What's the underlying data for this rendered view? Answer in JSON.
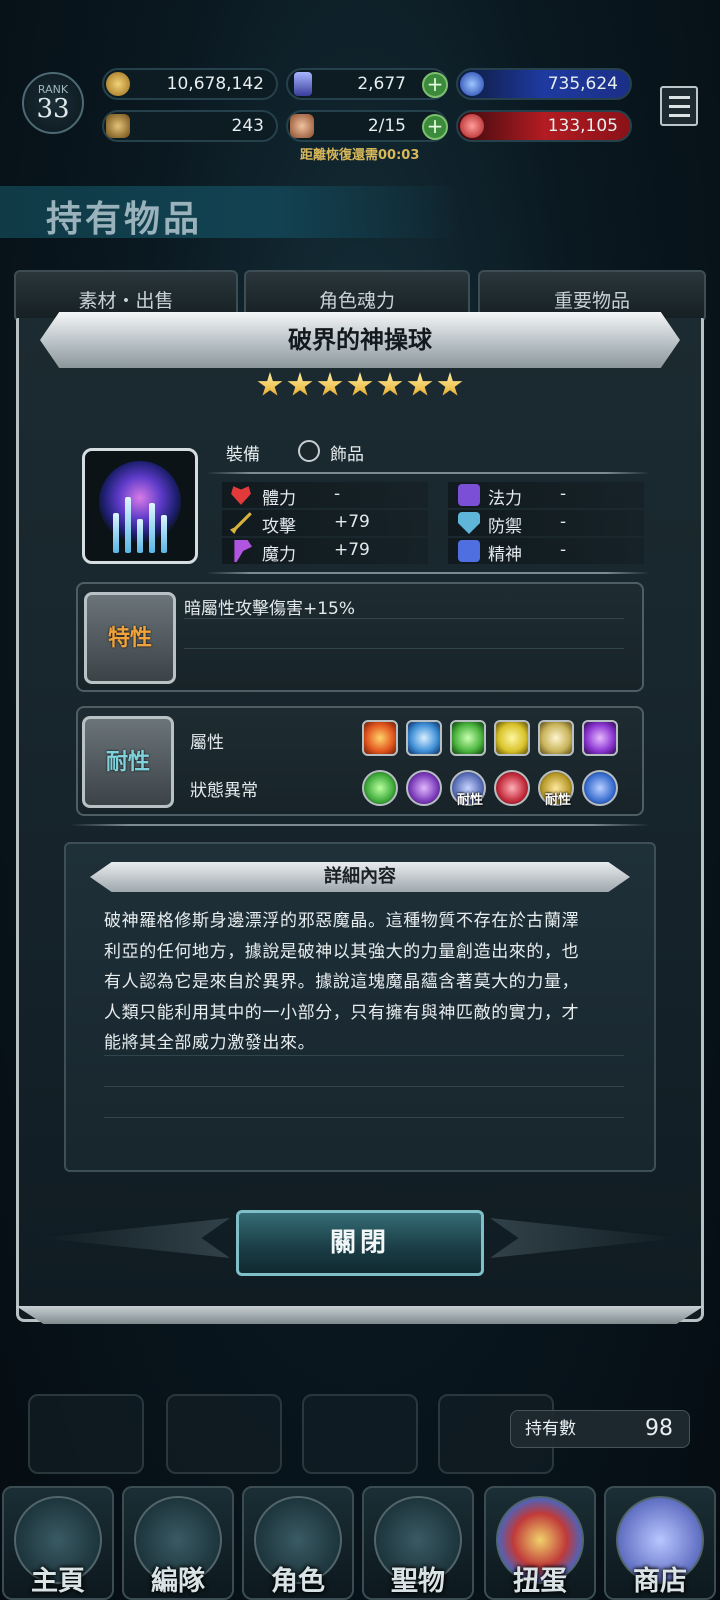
{
  "top": {
    "rank_label": "RANK",
    "rank_value": "33",
    "gold": "10,678,142",
    "crystal": "2,677",
    "blue_res": "735,624",
    "trophy": "243",
    "stamina": "2/15",
    "red_res": "133,105",
    "recover_text": "距離恢復還需00:03"
  },
  "page": {
    "title": "持有物品",
    "tabs": [
      "素材・出售",
      "角色魂力",
      "重要物品"
    ]
  },
  "item": {
    "name": "破界的神操球",
    "stars": 7,
    "equip_label": "裝備",
    "equip_type": "飾品",
    "stats": [
      {
        "label": "體力",
        "value": "-",
        "icon": "heart-icon",
        "color": "#e23a3a"
      },
      {
        "label": "法力",
        "value": "-",
        "icon": "mana-icon",
        "color": "#7b4fd6"
      },
      {
        "label": "攻擊",
        "value": "+79",
        "icon": "sword-icon",
        "color": "#d8b23a"
      },
      {
        "label": "防禦",
        "value": "-",
        "icon": "shield-icon",
        "color": "#5fb6d8"
      },
      {
        "label": "魔力",
        "value": "+79",
        "icon": "magic-icon",
        "color": "#b055e0"
      },
      {
        "label": "精神",
        "value": "-",
        "icon": "spirit-icon",
        "color": "#4f6ee0"
      }
    ],
    "trait_badge": "特性",
    "trait_text": "暗屬性攻擊傷害+15%",
    "resist_badge": "耐性",
    "attr_label": "屬性",
    "status_label": "狀態異常",
    "attr_icons": [
      {
        "name": "fire-element-icon",
        "color": "#e2561e"
      },
      {
        "name": "ice-element-icon",
        "color": "#3d8ed6"
      },
      {
        "name": "wind-element-icon",
        "color": "#49b33c"
      },
      {
        "name": "lightning-element-icon",
        "color": "#d8c22a"
      },
      {
        "name": "light-element-icon",
        "color": "#c9b45a"
      },
      {
        "name": "dark-element-icon",
        "color": "#8a35d0"
      }
    ],
    "status_icons": [
      {
        "name": "poison-status-icon",
        "color": "#3eaa3a",
        "tag": ""
      },
      {
        "name": "blind-status-icon",
        "color": "#7a3ab8",
        "tag": ""
      },
      {
        "name": "sleep-status-icon",
        "color": "#5a6fb8",
        "tag": "耐性"
      },
      {
        "name": "death-status-icon",
        "color": "#c22a3a",
        "tag": ""
      },
      {
        "name": "paralyze-status-icon",
        "color": "#b89a2a",
        "tag": "耐性"
      },
      {
        "name": "confuse-status-icon",
        "color": "#3a6ed0",
        "tag": ""
      }
    ],
    "detail_title": "詳細內容",
    "description": [
      "破神羅格修斯身邊漂浮的邪惡魔晶。這種物質不存在於古蘭澤",
      "利亞的任何地方，據說是破神以其強大的力量創造出來的，也",
      "有人認為它是來自於異界。據說這塊魔晶蘊含著莫大的力量，",
      "人類只能利用其中的一小部分，只有擁有與神匹敵的實力，才",
      "能將其全部威力激發出來。"
    ],
    "close_label": "關閉"
  },
  "owned": {
    "label": "持有數",
    "count": "98"
  },
  "nav": [
    "主頁",
    "編隊",
    "角色",
    "聖物",
    "扭蛋",
    "商店"
  ]
}
